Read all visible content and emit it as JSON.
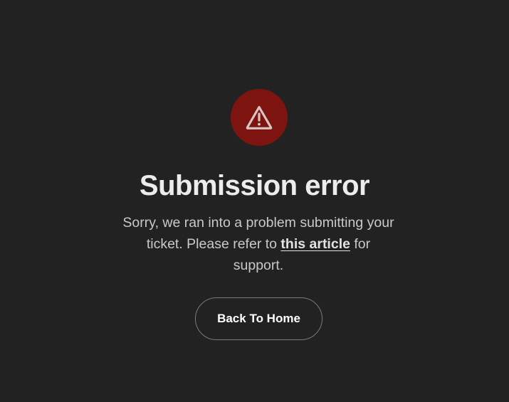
{
  "error": {
    "icon": "warning-triangle-icon",
    "title": "Submission error",
    "message_before_link": "Sorry, we ran into a problem submitting your ticket. Please refer to ",
    "link_text": "this article",
    "message_after_link": " for support.",
    "button_label": "Back To Home"
  },
  "colors": {
    "background": "#222222",
    "icon_circle": "#7e1410",
    "icon_stroke": "#d9c3c3",
    "title": "#ececec",
    "body_text": "#c9c9c9",
    "button_border": "#7a7a7a"
  }
}
